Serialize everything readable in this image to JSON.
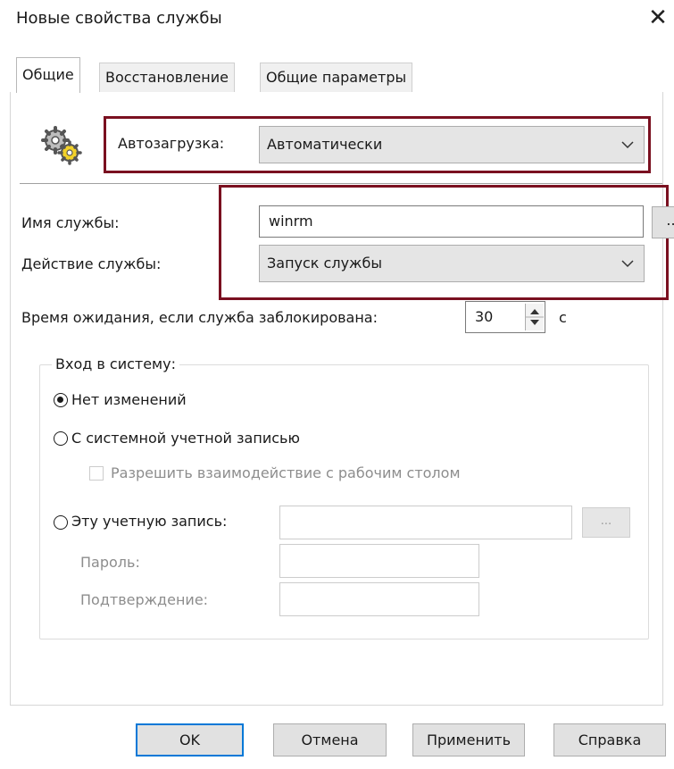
{
  "window": {
    "title": "Новые свойства службы",
    "close_glyph": "✕"
  },
  "tabs": [
    {
      "label": "Общие"
    },
    {
      "label": "Восстановление"
    },
    {
      "label": "Общие параметры"
    }
  ],
  "startup": {
    "label": "Автозагрузка:",
    "value": "Автоматически"
  },
  "service_name": {
    "label": "Имя службы:",
    "value": "winrm",
    "browse_label": "..."
  },
  "service_action": {
    "label": "Действие службы:",
    "value": "Запуск службы"
  },
  "timeout": {
    "label": "Время ожидания, если служба заблокирована:",
    "value": "30",
    "unit": "с"
  },
  "logon": {
    "group_title": "Вход в систему:",
    "no_change_label": "Нет изменений",
    "system_account_label": "С системной учетной записью",
    "desktop_interact_label": "Разрешить взаимодействие с рабочим столом",
    "this_account_label": "Эту учетную запись:",
    "this_account_browse": "...",
    "password_label": "Пароль:",
    "confirm_label": "Подтверждение:",
    "selected": "no_change"
  },
  "buttons": {
    "ok": "OK",
    "cancel": "Отмена",
    "apply": "Применить",
    "help": "Справка"
  },
  "icons": {
    "gear": "gears-icon"
  },
  "colors": {
    "highlight": "#7a1020",
    "ok_border": "#0078d7"
  }
}
